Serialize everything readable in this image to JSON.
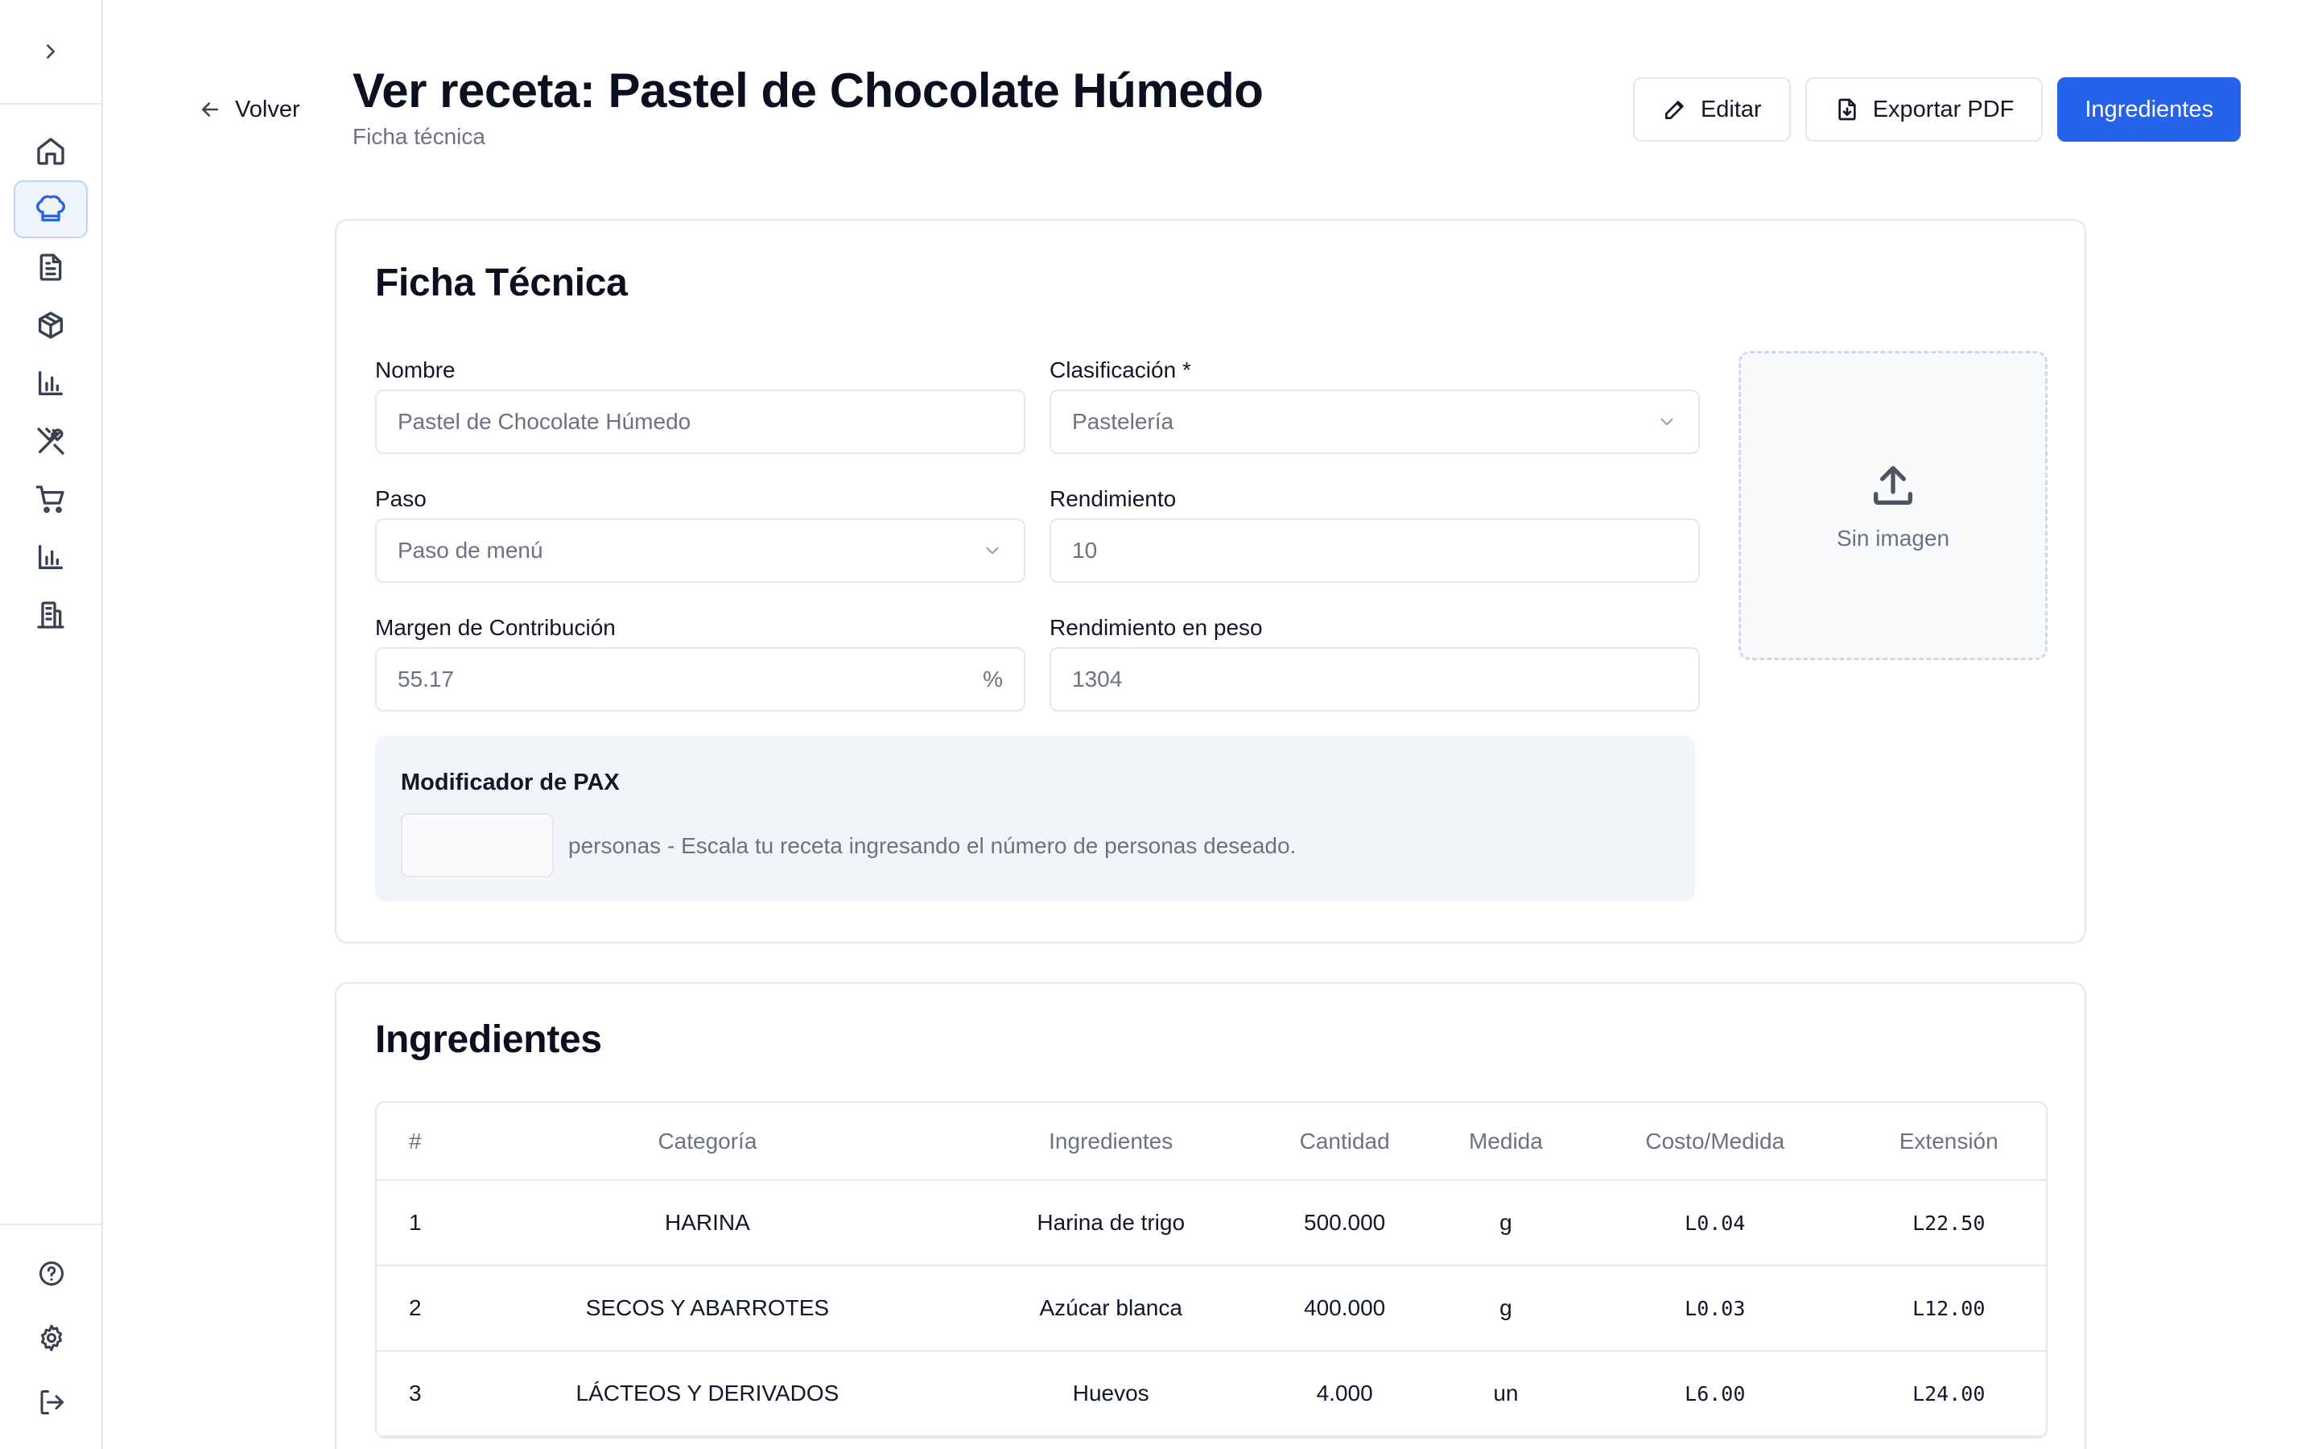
{
  "header": {
    "back_label": "Volver",
    "title": "Ver receta: Pastel de Chocolate Húmedo",
    "subtitle": "Ficha técnica",
    "edit_label": "Editar",
    "export_label": "Exportar PDF",
    "ingredients_label": "Ingredientes"
  },
  "sidebar": {
    "items": [
      {
        "icon": "home-icon"
      },
      {
        "icon": "chef-hat-icon",
        "active": true
      },
      {
        "icon": "document-icon"
      },
      {
        "icon": "package-icon"
      },
      {
        "icon": "bar-chart-icon"
      },
      {
        "icon": "utensils-crossed-icon"
      },
      {
        "icon": "shopping-cart-icon"
      },
      {
        "icon": "bar-chart-icon"
      },
      {
        "icon": "building-icon"
      }
    ],
    "bottom": [
      {
        "icon": "help-icon"
      },
      {
        "icon": "gear-icon"
      },
      {
        "icon": "logout-icon"
      }
    ]
  },
  "ficha": {
    "title": "Ficha Técnica",
    "nombre_label": "Nombre",
    "nombre_value": "Pastel de Chocolate Húmedo",
    "clasificacion_label": "Clasificación *",
    "clasificacion_value": "Pastelería",
    "paso_label": "Paso",
    "paso_value": "Paso de menú",
    "rendimiento_label": "Rendimiento",
    "rendimiento_value": "10",
    "margen_label": "Margen de Contribución",
    "margen_value": "55.17",
    "margen_suffix": "%",
    "rend_peso_label": "Rendimiento en peso",
    "rend_peso_value": "1304",
    "image_label": "Sin imagen",
    "pax_title": "Modificador de PAX",
    "pax_help": "personas - Escala tu receta ingresando el número de personas deseado."
  },
  "ingredientes": {
    "title": "Ingredientes",
    "columns": [
      "#",
      "Categoría",
      "Ingredientes",
      "Cantidad",
      "Medida",
      "Costo/Medida",
      "Extensión"
    ],
    "rows": [
      [
        "1",
        "HARINA",
        "Harina de trigo",
        "500.000",
        "g",
        "L0.04",
        "L22.50"
      ],
      [
        "2",
        "SECOS Y ABARROTES",
        "Azúcar blanca",
        "400.000",
        "g",
        "L0.03",
        "L12.00"
      ],
      [
        "3",
        "LÁCTEOS Y DERIVADOS",
        "Huevos",
        "4.000",
        "un",
        "L6.00",
        "L24.00"
      ]
    ]
  },
  "colors": {
    "primary": "#2563eb",
    "active_bg": "#eff4ff",
    "pax_bg": "#f1f4f9"
  }
}
